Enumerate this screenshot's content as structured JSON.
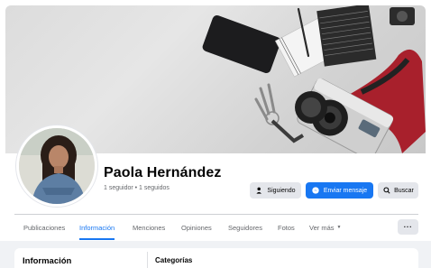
{
  "profile": {
    "name": "Paola Hernández",
    "followers": "1 seguidor • 1 seguidos"
  },
  "actions": {
    "following_label": "Siguiendo",
    "message_label": "Enviar mensaje",
    "search_label": "Buscar"
  },
  "tabs": [
    {
      "label": "Publicaciones",
      "active": false
    },
    {
      "label": "Información",
      "active": true
    },
    {
      "label": "Menciones",
      "active": false
    },
    {
      "label": "Opiniones",
      "active": false
    },
    {
      "label": "Seguidores",
      "active": false
    },
    {
      "label": "Fotos",
      "active": false
    },
    {
      "label": "Ver más",
      "active": false
    }
  ],
  "more_menu_label": "···",
  "info": {
    "title": "Información",
    "categories_title": "Categorías"
  },
  "colors": {
    "accent": "#1877f2",
    "secondary_button": "#e4e6eb",
    "muted_text": "#65676b",
    "page_background": "#f0f2f5"
  },
  "icons": {
    "following": "user-check-icon",
    "message": "messenger-icon",
    "search": "search-icon",
    "more": "more-dots-icon",
    "dropdown": "caret-down-icon"
  }
}
